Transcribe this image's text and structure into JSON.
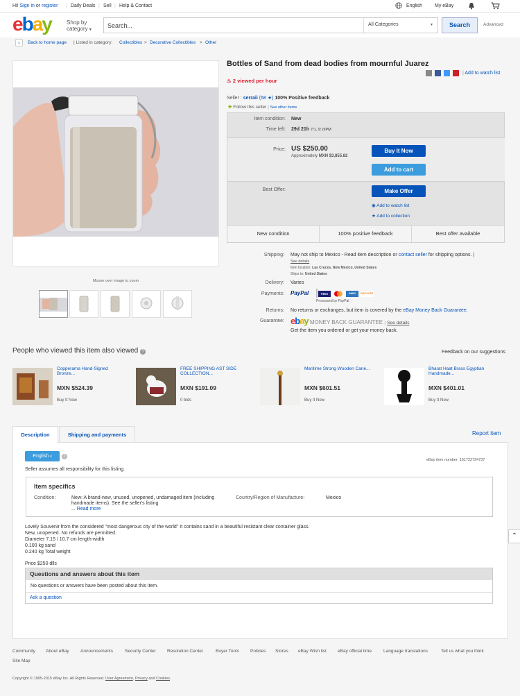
{
  "topbar": {
    "greeting": "Hi!",
    "sign_in": "Sign in",
    "or": "or",
    "register": "register",
    "daily_deals": "Daily Deals",
    "sell": "Sell",
    "help": "Help & Contact",
    "language": "English",
    "my_ebay": "My eBay"
  },
  "header": {
    "logo_letters": [
      "e",
      "b",
      "a",
      "y"
    ],
    "logo_colors": [
      "#e53238",
      "#0064d2",
      "#f5af02",
      "#86b817"
    ],
    "shop_by_category": "Shop by category",
    "search_placeholder": "Search...",
    "category_select": "All Categories",
    "search_button": "Search",
    "advanced": "Advanced"
  },
  "breadcrumb": {
    "back": "Back to home page",
    "listed_in": "| Listed in category:",
    "crumbs": [
      "Collectibles",
      "Decorative Collectibles",
      "Other"
    ],
    "sep": ">"
  },
  "image": {
    "zoom_hint": "Mouse over image to zoom"
  },
  "item": {
    "title": "Bottles of Sand from dead bodies from mournful Juarez",
    "viewed": "2 viewed per hour",
    "add_watch": "Add to watch list",
    "seller_label": "Seller :",
    "seller_name": "serraii",
    "seller_score": "(68",
    "seller_score_close": ")",
    "feedback": "100% Positive feedback",
    "follow": "Follow this seller",
    "other_items": "See other items",
    "condition_label": "Item condition:",
    "condition_value": "New",
    "time_left_label": "Time left:",
    "time_left_value": "29d 21h",
    "time_left_date": "7/1, 9:19PM",
    "price_label": "Price:",
    "price_value": "US $250.00",
    "approx_label": "Approximately",
    "approx_value": "MXN $3,855.82",
    "buy_now": "Buy It Now",
    "add_cart": "Add to cart",
    "best_offer_label": "Best Offer:",
    "make_offer": "Make Offer",
    "add_watch_list": "Add to watch list",
    "add_collection": "Add to collection",
    "features": [
      "New condition",
      "100% positive feedback",
      "Best offer available"
    ]
  },
  "shipping": {
    "shipping_label": "Shipping:",
    "shipping_value": "May not ship to Mexico - Read item description or",
    "contact_seller": "contact seller",
    "shipping_tail": "for shipping options. |",
    "see_details": "See details",
    "item_location_label": "Item location:",
    "item_location": "Las Cruces, New Mexico, United States",
    "ships_to_label": "Ships to:",
    "ships_to": "United States",
    "delivery_label": "Delivery:",
    "delivery_value": "Varies",
    "payments_label": "Payments:",
    "paypal": "PayPal",
    "processed_by": "Processed by PayPal",
    "card_names": [
      "VISA",
      "MC",
      "AMEX",
      "DISCOVER"
    ],
    "returns_label": "Returns:",
    "returns_value": "No returns or exchanges, but item is covered by the",
    "returns_link": "eBay Money Back Guarantee.",
    "guarantee_label": "Guarantee:",
    "mbg_text": "MONEY BACK GUARANTEE",
    "mbg_see": "See details",
    "mbg_sub": "Get the item you ordered or get your money back."
  },
  "recommendations": {
    "title": "People who viewed this item also viewed",
    "feedback_link": "Feedback on our suggestions",
    "items": [
      {
        "title": "Copperama Hand-Signed Bronze...",
        "price": "MXN $524.39",
        "sub": "Buy It Now"
      },
      {
        "title": "FREE SHIPPING AST SIDE COLLECTION...",
        "price": "MXN $191.09",
        "sub": "0 bids"
      },
      {
        "title": "Maritime Strong Wooden Cane...",
        "price": "MXN $601.51",
        "sub": "Buy It Now"
      },
      {
        "title": "Bharat Haat Brass Egyptian Handmade...",
        "price": "MXN $401.01",
        "sub": "Buy It Now"
      }
    ]
  },
  "description": {
    "tab_description": "Description",
    "tab_shipping": "Shipping and payments",
    "report_item": "Report item",
    "lang_button": "English",
    "item_number_label": "eBay item number:",
    "item_number": "161722724737",
    "seller_responsibility": "Seller assumes all responsibility for this listing.",
    "specifics_title": "Item specifics",
    "condition_label": "Condition:",
    "condition_value": "New: A brand-new, unused, unopened, undamaged item (including handmade items). See the seller's listing",
    "read_more": "Read more",
    "read_more_prefix": "...",
    "country_label": "Country/Region of Manufacture:",
    "country_value": "Mexico",
    "body_lines": [
      "Lovely Souvenir from the considered \"most dangerous city of the world\" It contains sand in a beautiful resistant clear container glass.",
      "New, unopened. No refunds are permitted.",
      "Diameter 7.15 / 10.7 cm length-width",
      "0.100 kg sand",
      "0.240 kg Total weight"
    ],
    "price_line": "Price $250 dlls",
    "qa_title": "Questions and answers about this item",
    "qa_empty": "No questions or answers have been posted about this item.",
    "ask_question": "Ask a question"
  },
  "footer": {
    "links": [
      "Community",
      "About eBay",
      "Announcements",
      "Security Center",
      "Resolution Center",
      "Buyer Tools",
      "Policies",
      "Stores",
      "eBay Wish list",
      "eBay official time",
      "Language translations",
      "Tell us what you think"
    ],
    "site_map": "Site Map",
    "copyright": "Copyright © 1995-2015 eBay Inc. All Rights Reserved.",
    "user_agreement": "User Agreement",
    "privacy": "Privacy",
    "and": "and",
    "cookies": "Cookies"
  }
}
